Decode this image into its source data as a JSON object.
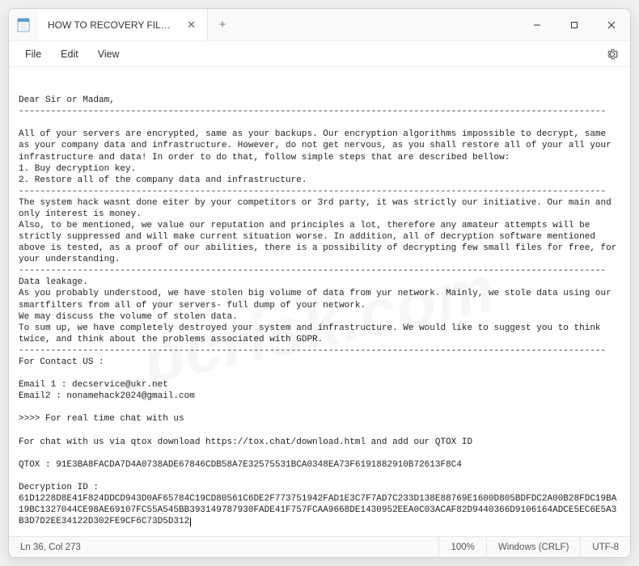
{
  "titlebar": {
    "tab_label": "HOW TO RECOVERY FILES.TXT",
    "close_label": "✕",
    "newtab_label": "+",
    "minimize": "—",
    "maximize": "☐",
    "close": "✕"
  },
  "menu": {
    "file": "File",
    "edit": "Edit",
    "view": "View"
  },
  "body": {
    "greeting": "Dear Sir or Madam,",
    "sep1": "--------------------------------------------------------------------------------------------------------------",
    "p1": "All of your servers are encrypted, same as your backups. Our encryption algorithms impossible to decrypt, same as your company data and infrastructure. However, do not get nervous, as you shall restore all of your all your infrastructure and data! In order to do that, follow simple steps that are described bellow:",
    "step1": "1. Buy decryption key.",
    "step2": "2. Restore all of the company data and infrastructure.",
    "sep2": "--------------------------------------------------------------------------------------------------------------",
    "p2a": "The system hack wasnt done eiter by your competitors or 3rd party, it was strictly our initiative. Our main and only interest is money.",
    "p2b": "Also, to be mentioned, we value our reputation and principles a lot, therefore any amateur attempts will be strictly suppressed and will make current situation worse. In addition, all of decryption software mentioned above is tested, as a proof of our abilities, there is a possibility of decrypting few small files for free, for your understanding.",
    "sep3": "--------------------------------------------------------------------------------------------------------------",
    "p3_head": "Data leakage.",
    "p3_1": "As you probably understood, we have stolen big volume of data from yur network. Mainly, we stole data using our smartfilters from all of your servers- full dump of your network.",
    "p3_2": "We may discuss the volume of stolen data.",
    "p3_3": "To sum up, we have completely destroyed your system and infrastructure. We would like to suggest you to think twice, and think about the problems associated with GDPR.",
    "sep4": "--------------------------------------------------------------------------------------------------------------",
    "contact_head": "For Contact US :",
    "email1": "Email 1 : decservice@ukr.net",
    "email2": "Email2 : nonamehack2024@gmail.com",
    "chat_head": ">>>> For real time chat with us",
    "chat_info": "For chat with us via qtox download https://tox.chat/download.html and add our QTOX ID",
    "qtox": "QTOX : 91E3BA8FACDA7D4A0738ADE67846CDB58A7E32575531BCA0348EA73F6191882910B72613F8C4",
    "dec_label": "Decryption ID :",
    "dec_id": "61D1228D8E41F824DDCD943D0AF65784C19CD80561C6DE2F773751942FAD1E3C7F7AD7C233D138E88769E1600D805BDFDC2A00B28FDC19BA19BC1327044CE98AE69107FC55A545BB393149787930FADE41F757FCAA9668DE1430952EEA0C03ACAF82D9440366D9106164ADCE5EC6E5A3B3D7D2EE34122D302FE9CF6C73D5D312"
  },
  "status": {
    "pos": "Ln 36, Col 273",
    "zoom": "100%",
    "eol": "Windows (CRLF)",
    "enc": "UTF-8"
  },
  "watermark": "pcrisk.com"
}
